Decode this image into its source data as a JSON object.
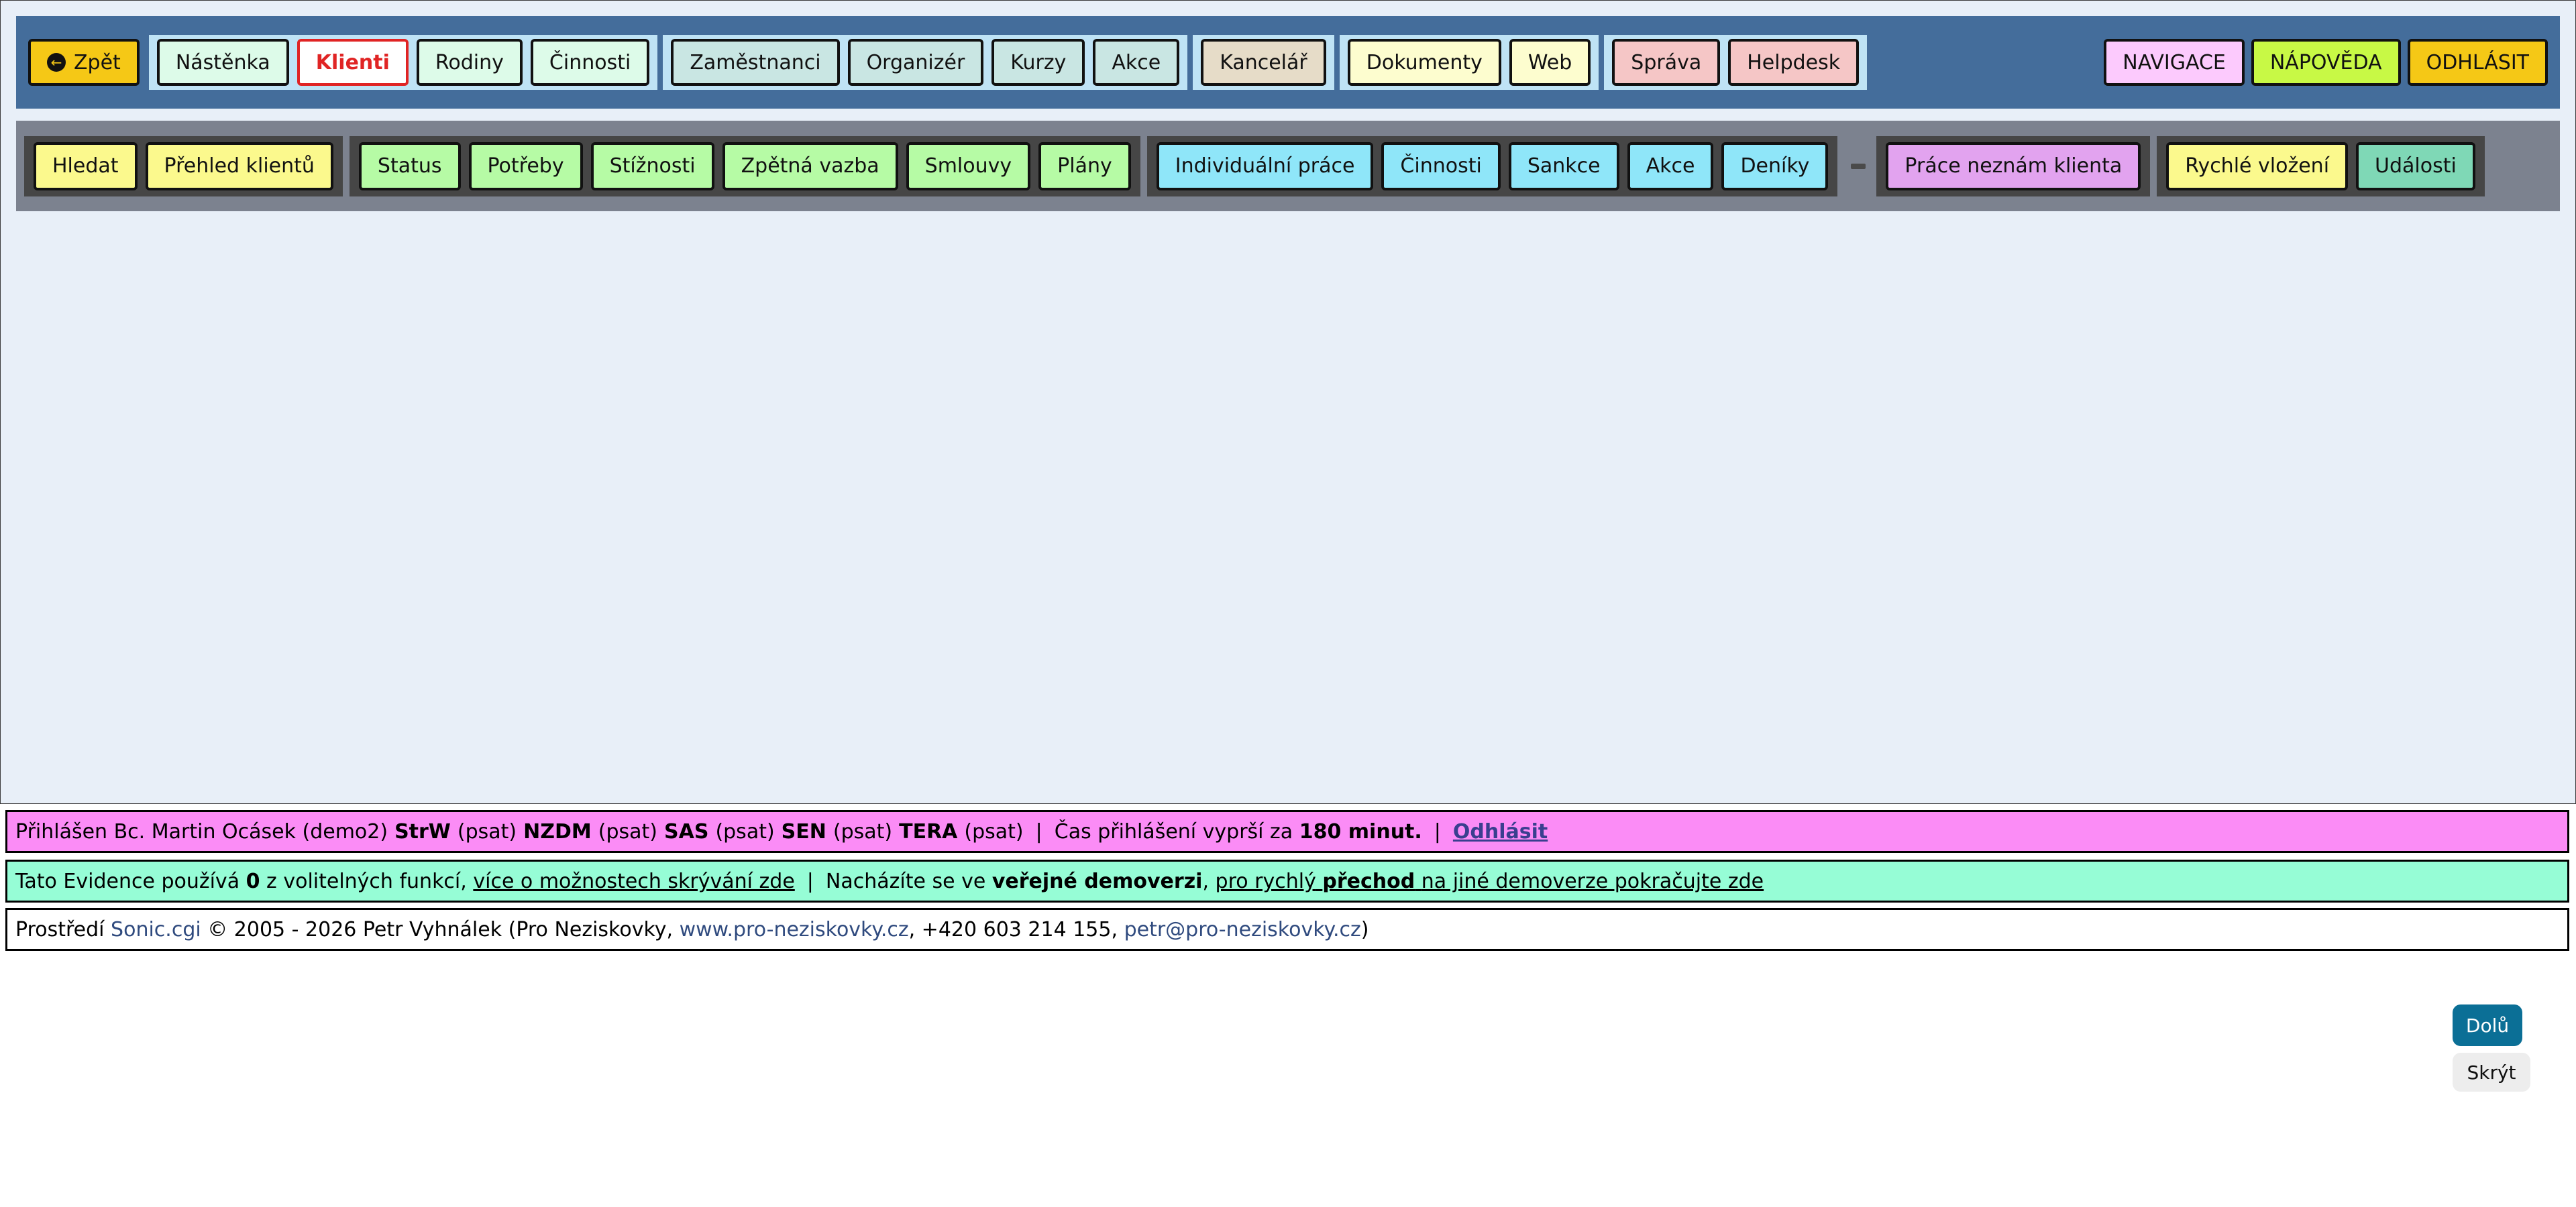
{
  "colors": {
    "top_bar": "#446d9b",
    "sub_bar": "#7c828f",
    "content_bg": "#e8eff8",
    "active_red": "#e02424"
  },
  "topnav": {
    "back": {
      "label": "Zpět",
      "icon": "arrow-left-circle-icon",
      "color": "#f5c816"
    },
    "groups": [
      {
        "items": [
          {
            "id": "nastenka",
            "label": "Nástěnka",
            "color": "#ddfbe9"
          },
          {
            "id": "klienti",
            "label": "Klienti",
            "color": "#ffffff",
            "active": true
          },
          {
            "id": "rodiny",
            "label": "Rodiny",
            "color": "#ddfbe9"
          },
          {
            "id": "cinnosti",
            "label": "Činnosti",
            "color": "#ddfbe9"
          }
        ]
      },
      {
        "items": [
          {
            "id": "zamestnanci",
            "label": "Zaměstnanci",
            "color": "#c9e6e3"
          },
          {
            "id": "organizer",
            "label": "Organizér",
            "color": "#c9e6e3"
          },
          {
            "id": "kurzy",
            "label": "Kurzy",
            "color": "#c9e6e3"
          },
          {
            "id": "akce",
            "label": "Akce",
            "color": "#c9e6e3"
          }
        ]
      },
      {
        "items": [
          {
            "id": "kancelar",
            "label": "Kancelář",
            "color": "#e6dcc8"
          }
        ]
      },
      {
        "items": [
          {
            "id": "dokumenty",
            "label": "Dokumenty",
            "color": "#fdfdcf"
          },
          {
            "id": "web",
            "label": "Web",
            "color": "#fdfdcf"
          }
        ]
      },
      {
        "items": [
          {
            "id": "sprava",
            "label": "Správa",
            "color": "#f5c6c6"
          },
          {
            "id": "helpdesk",
            "label": "Helpdesk",
            "color": "#f5c6c6"
          }
        ]
      }
    ],
    "right": [
      {
        "id": "navigace",
        "label": "NAVIGACE",
        "color": "#fccafd"
      },
      {
        "id": "napoveda",
        "label": "NÁPOVĚDA",
        "color": "#c8f945"
      },
      {
        "id": "odhlasit",
        "label": "ODHLÁSIT",
        "color": "#f5c816"
      }
    ]
  },
  "subnav": {
    "groups": [
      {
        "items": [
          {
            "id": "hledat",
            "label": "Hledat",
            "color": "#fbf98d"
          },
          {
            "id": "prehled-klientu",
            "label": "Přehled klientů",
            "color": "#fbf98d"
          }
        ]
      },
      {
        "items": [
          {
            "id": "status",
            "label": "Status",
            "color": "#b6fba5"
          },
          {
            "id": "potreby",
            "label": "Potřeby",
            "color": "#b6fba5"
          },
          {
            "id": "stiznosti",
            "label": "Stížnosti",
            "color": "#b6fba5"
          },
          {
            "id": "zpetna-vazba",
            "label": "Zpětná vazba",
            "color": "#b6fba5"
          },
          {
            "id": "smlouvy",
            "label": "Smlouvy",
            "color": "#b6fba5"
          },
          {
            "id": "plany",
            "label": "Plány",
            "color": "#b6fba5"
          }
        ]
      },
      {
        "items": [
          {
            "id": "individualni-prace",
            "label": "Individuální práce",
            "color": "#8fe6f9"
          },
          {
            "id": "cinnosti-sub",
            "label": "Činnosti",
            "color": "#8fe6f9"
          },
          {
            "id": "sankce",
            "label": "Sankce",
            "color": "#8fe6f9"
          },
          {
            "id": "akce-sub",
            "label": "Akce",
            "color": "#8fe6f9"
          },
          {
            "id": "deniky",
            "label": "Deníky",
            "color": "#8fe6f9"
          }
        ]
      },
      {
        "separator": true,
        "items": [
          {
            "id": "prace-neznam",
            "label": "Práce neznám klienta",
            "color": "#e2a3ef"
          }
        ]
      },
      {
        "items": [
          {
            "id": "rychle-vlozeni",
            "label": "Rychlé vložení",
            "color": "#fbf98d"
          },
          {
            "id": "udalosti",
            "label": "Události",
            "color": "#7fd8b6"
          }
        ]
      }
    ]
  },
  "login": {
    "prefix": "Přihlášen Bc. Martin Ocásek (demo2)",
    "units": [
      {
        "name": "StrW",
        "mode": "(psat)"
      },
      {
        "name": "NZDM",
        "mode": "(psat)"
      },
      {
        "name": "SAS",
        "mode": "(psat)"
      },
      {
        "name": "SEN",
        "mode": "(psat)"
      },
      {
        "name": "TERA",
        "mode": "(psat)"
      }
    ],
    "sep": "|",
    "expiry_text": "Čas přihlášení vyprší za",
    "expiry_value": "180 minut.",
    "logout_link": "Odhlásit"
  },
  "evidence": {
    "t1": "Tato Evidence používá",
    "count": "0",
    "t2": "z volitelných funkcí,",
    "link1": "více o možnostech skrývání zde",
    "sep": "|",
    "t3": "Nacházíte se ve",
    "bold1": "veřejné demoverzi",
    "t4": ",",
    "link2a": "pro rychlý",
    "link2b": "přechod",
    "link2c": "na jiné demoverze pokračujte zde"
  },
  "footer": {
    "t1": "Prostředí",
    "link_sonic": "Sonic.cgi",
    "t2": "© 2005 - 2026 Petr Vyhnálek (Pro Neziskovky,",
    "link_web": "www.pro-neziskovky.cz",
    "t3": ", +420 603 214 155,",
    "link_mail": "petr@pro-neziskovky.cz",
    "t4": ")"
  },
  "scroll": {
    "down_label": "Dolů",
    "hide_label": "Skrýt"
  }
}
